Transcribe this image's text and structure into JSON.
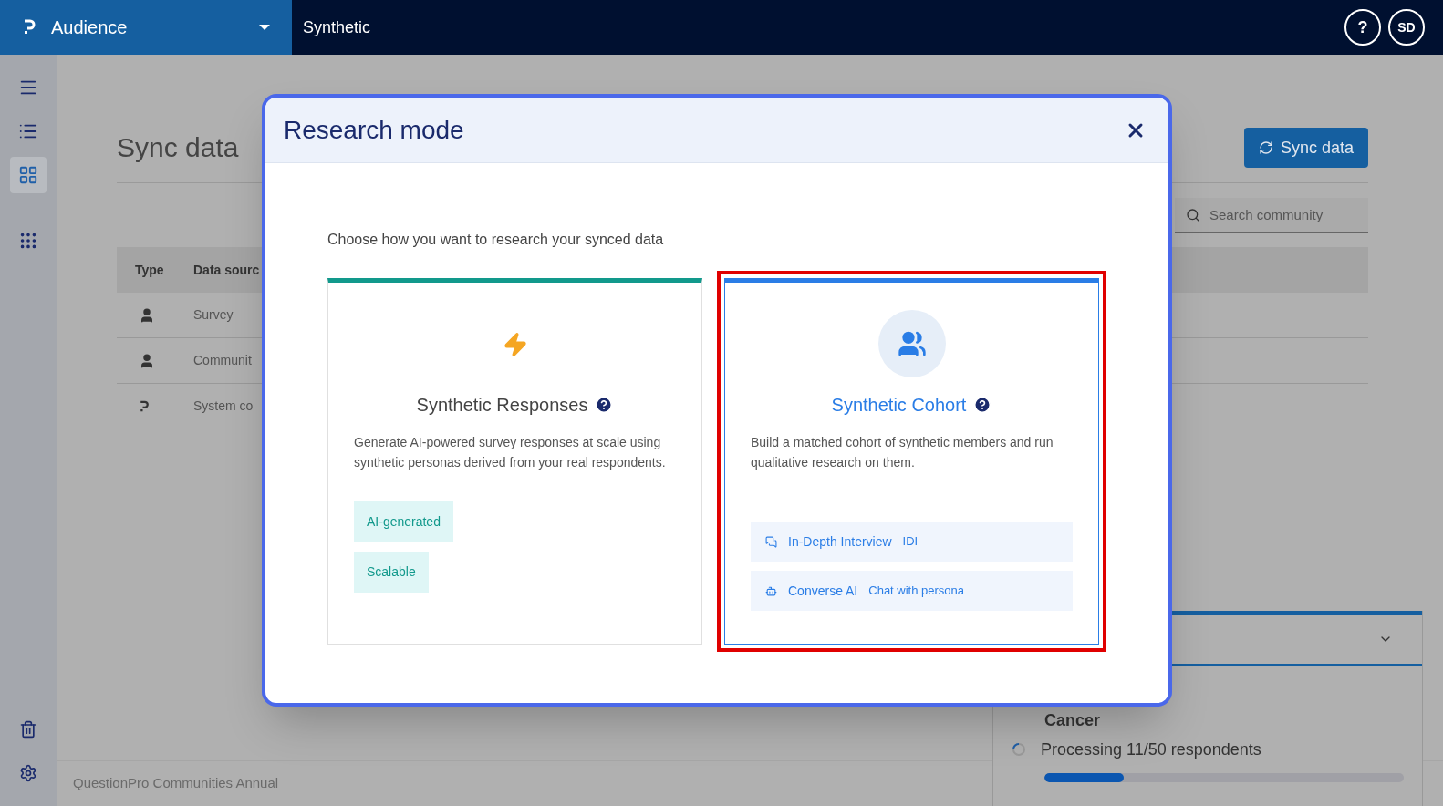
{
  "topbar": {
    "workspace": "Audience",
    "title": "Synthetic",
    "help": "?",
    "avatar": "SD"
  },
  "sidebar": {
    "items": [
      {
        "selected": false
      },
      {
        "selected": false
      },
      {
        "selected": true
      },
      {
        "selected": false
      }
    ]
  },
  "page": {
    "title": "Sync data",
    "sync_button": "Sync data",
    "search": {
      "placeholder": "Search community"
    },
    "table": {
      "columns": [
        "Type",
        "Data sourc"
      ],
      "rows": [
        {
          "source": "Survey"
        },
        {
          "source": "Communit"
        },
        {
          "source": "System co"
        }
      ]
    },
    "footer": "QuestionPro Communities Annual",
    "progress_panel": {
      "label": "Cancer",
      "status": "Processing 11/50 respondents",
      "level": 0.22
    }
  },
  "modal": {
    "title": "Research mode",
    "intro": "Choose how you want to research your synced data",
    "cards": [
      {
        "kind": "responses",
        "title": "Synthetic Responses",
        "highlighted": false,
        "description": "Generate AI-powered survey responses at scale using synthetic personas derived from your real respondents.",
        "tags": [
          "AI-generated",
          "Scalable"
        ]
      },
      {
        "kind": "cohort",
        "title": "Synthetic Cohort",
        "highlighted": true,
        "description": "Build a matched cohort of synthetic members and run qualitative research on them.",
        "options": [
          {
            "label": "In-Depth Interview",
            "note": "IDI"
          },
          {
            "label": "Converse AI",
            "note": "Chat with persona"
          }
        ]
      }
    ]
  }
}
